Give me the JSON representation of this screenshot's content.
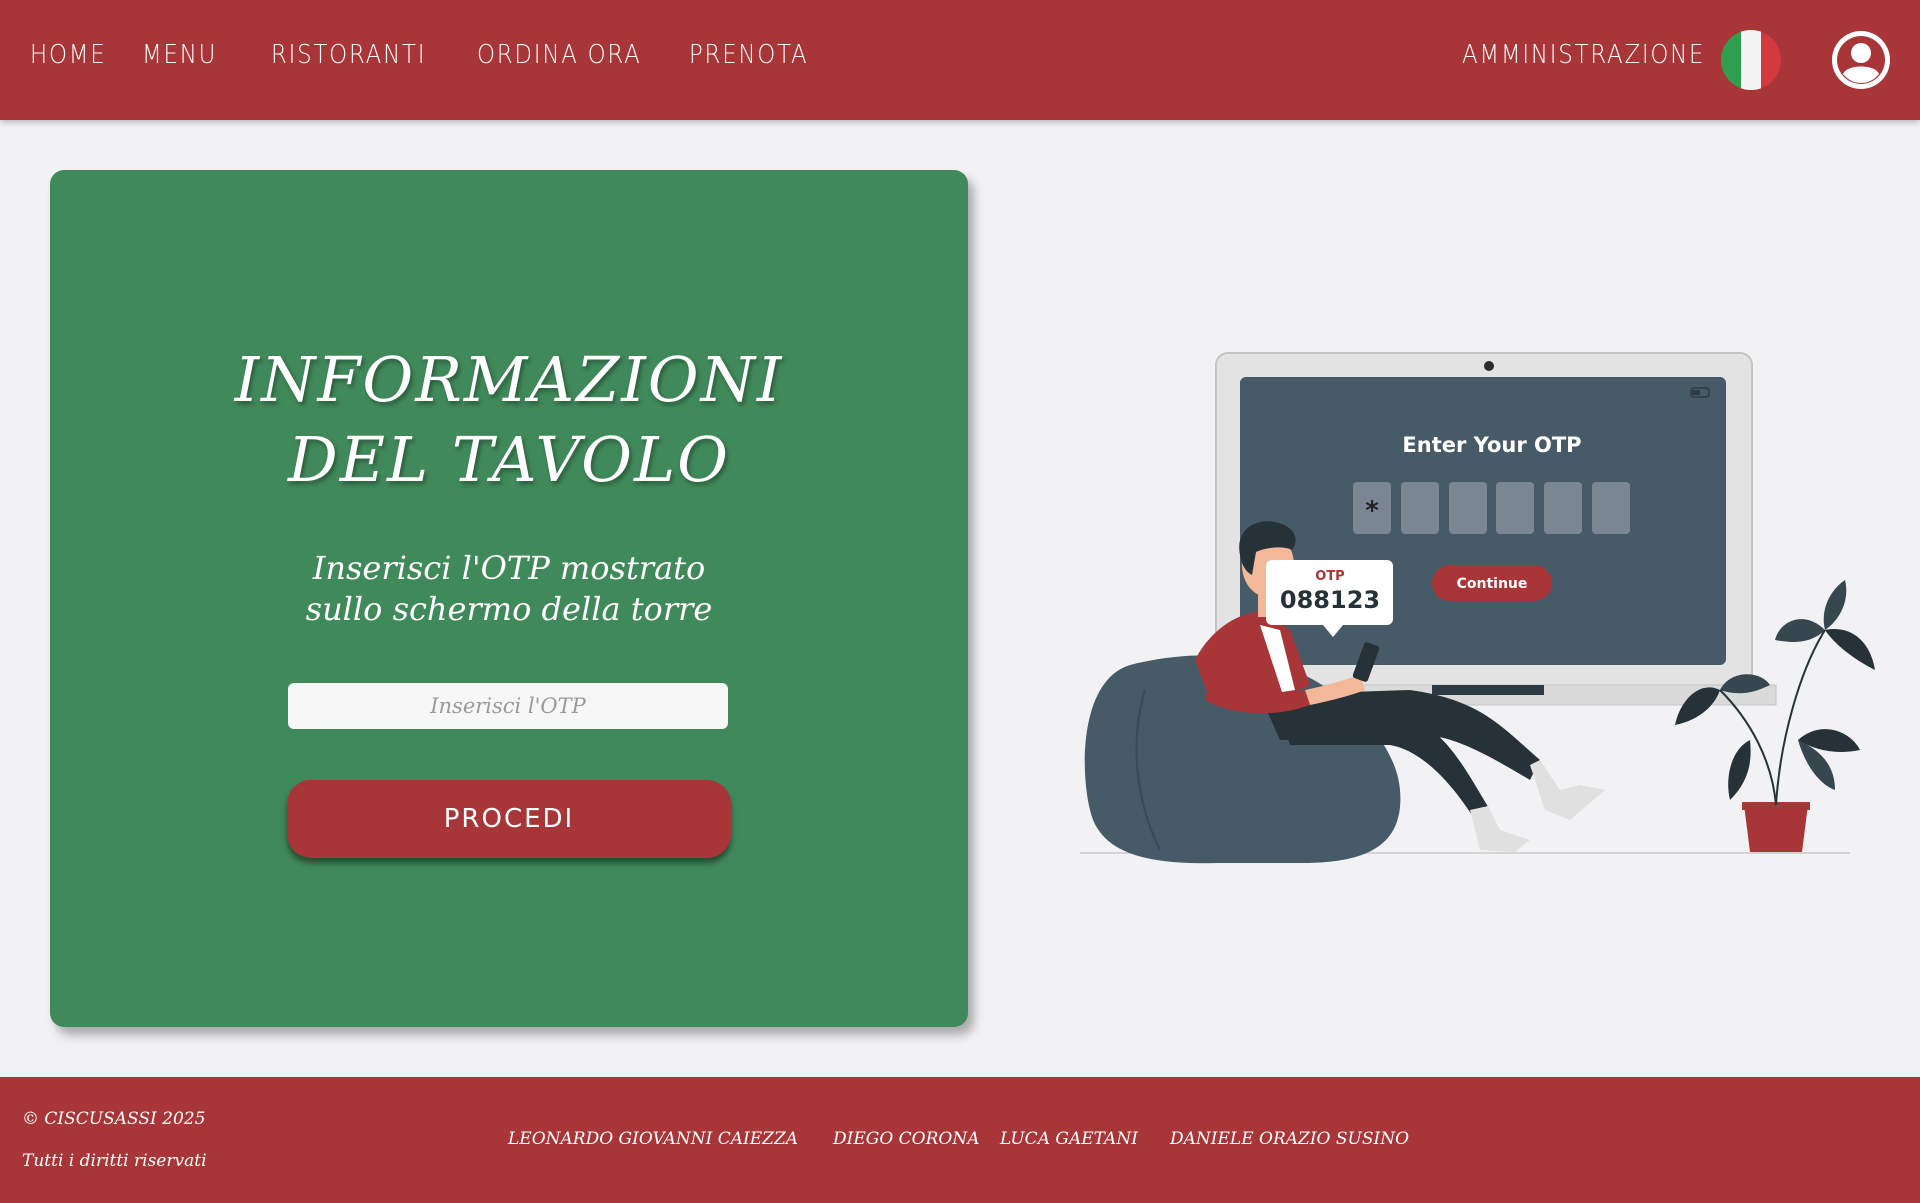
{
  "nav": {
    "home": "HOME",
    "menu": "MENU",
    "ristoranti": "RISTORANTI",
    "ordina_ora": "ORDINA ORA",
    "prenota": "PRENOTA",
    "amministrazione": "AMMINISTRAZIONE",
    "language_icon": "italy-flag-icon",
    "profile_icon": "user-avatar-icon"
  },
  "card": {
    "title_line1": "INFORMAZIONI",
    "title_line2": "DEL TAVOLO",
    "subtitle_line1": "Inserisci l'OTP mostrato",
    "subtitle_line2": "sullo schermo della torre",
    "input_placeholder": "Inserisci l'OTP",
    "button_label": "PROCEDI"
  },
  "illustration": {
    "screen_title": "Enter Your OTP",
    "first_box_char": "*",
    "continue_label": "Continue",
    "bubble_label": "OTP",
    "bubble_code": "088123"
  },
  "footer": {
    "copyright": "© CISCUSASSI 2025",
    "rights": "Tutti i diritti riservati",
    "authors": [
      "LEONARDO GIOVANNI CAIEZZA",
      "DIEGO CORONA",
      "LUCA GAETANI",
      "DANIELE ORAZIO SUSINO"
    ]
  },
  "colors": {
    "brand_red": "#a83638",
    "card_green": "#40895a",
    "background": "#f2f2f4",
    "screen_slate": "#475a68"
  }
}
